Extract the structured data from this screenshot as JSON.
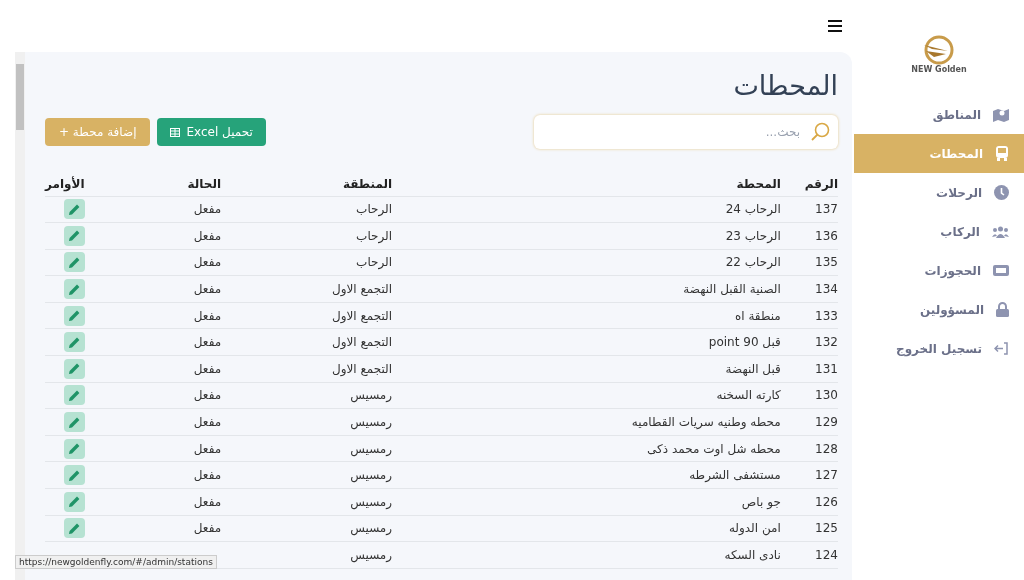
{
  "sidebar": {
    "logo": {
      "brand": "NEW Golden"
    },
    "items": [
      {
        "label": "المناطق",
        "selected": false
      },
      {
        "label": "المحطات",
        "selected": true
      },
      {
        "label": "الرحلات",
        "selected": false
      },
      {
        "label": "الركاب",
        "selected": false
      },
      {
        "label": "الحجوزات",
        "selected": false
      },
      {
        "label": "المسؤولين",
        "selected": false
      },
      {
        "label": "تسجيل الخروج",
        "selected": false
      }
    ]
  },
  "page": {
    "title": "المحطات",
    "search": {
      "placeholder": "بحث..."
    },
    "buttons": [
      {
        "kind": "excel",
        "label": "تحميل Excel"
      },
      {
        "kind": "add",
        "label": "إضافة محطة +"
      }
    ]
  },
  "table": {
    "columns": [
      "الرقم",
      "المحطة",
      "المنطقة",
      "الحالة",
      "الأوامر"
    ],
    "rows": [
      {
        "id": "137",
        "station": "الرحاب 24",
        "region": "الرحاب",
        "status": "مفعل"
      },
      {
        "id": "136",
        "station": "الرحاب 23",
        "region": "الرحاب",
        "status": "مفعل"
      },
      {
        "id": "135",
        "station": "الرحاب 22",
        "region": "الرحاب",
        "status": "مفعل"
      },
      {
        "id": "134",
        "station": "الصنية القبل النهضة",
        "region": "التجمع الاول",
        "status": "مفعل"
      },
      {
        "id": "133",
        "station": "منطقة اه",
        "region": "التجمع الاول",
        "status": "مفعل"
      },
      {
        "id": "132",
        "station": "قبل 90 point",
        "region": "التجمع الاول",
        "status": "مفعل"
      },
      {
        "id": "131",
        "station": "قبل النهضة",
        "region": "التجمع الاول",
        "status": "مفعل"
      },
      {
        "id": "130",
        "station": "كارته السخنه",
        "region": "رمسيس",
        "status": "مفعل"
      },
      {
        "id": "129",
        "station": "محطه وطنيه سريات القطاميه",
        "region": "رمسيس",
        "status": "مفعل"
      },
      {
        "id": "128",
        "station": "محطه شل اوت محمد ذكى",
        "region": "رمسيس",
        "status": "مفعل"
      },
      {
        "id": "127",
        "station": "مستشفى الشرطه",
        "region": "رمسيس",
        "status": "مفعل"
      },
      {
        "id": "126",
        "station": "جو باص",
        "region": "رمسيس",
        "status": "مفعل"
      },
      {
        "id": "125",
        "station": "امن الدوله",
        "region": "رمسيس",
        "status": "مفعل"
      },
      {
        "id": "124",
        "station": "نادى السكه",
        "region": "رمسيس"
      }
    ]
  },
  "status_bar": {
    "url": "https://newgoldenfly.com/#/admin/stations"
  }
}
